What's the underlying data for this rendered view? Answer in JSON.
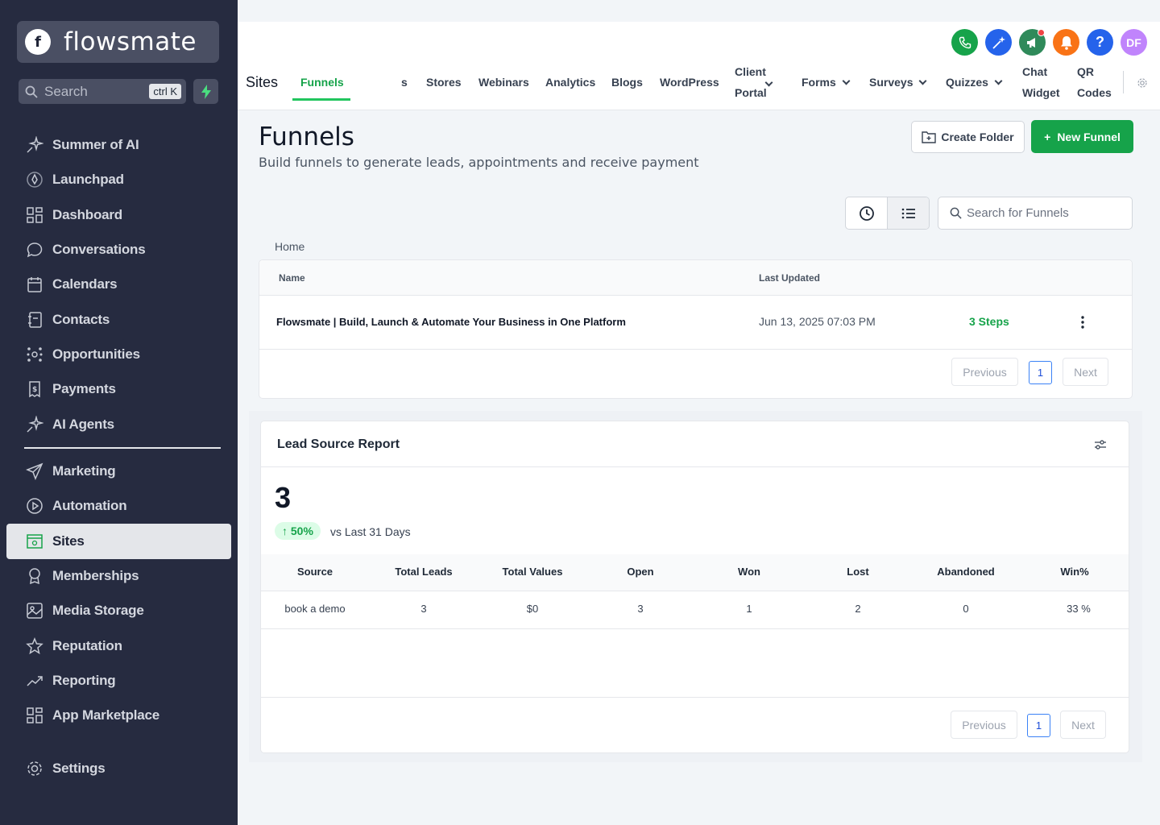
{
  "app": {
    "name": "flowsmate"
  },
  "sidebar": {
    "search_placeholder": "Search",
    "search_shortcut": "ctrl K",
    "items": [
      {
        "label": "Summer of AI",
        "icon": "sparkle-icon"
      },
      {
        "label": "Launchpad",
        "icon": "rocket-icon"
      },
      {
        "label": "Dashboard",
        "icon": "grid-icon"
      },
      {
        "label": "Conversations",
        "icon": "chat-bubble-icon"
      },
      {
        "label": "Calendars",
        "icon": "calendar-icon"
      },
      {
        "label": "Contacts",
        "icon": "contacts-icon"
      },
      {
        "label": "Opportunities",
        "icon": "opportunities-icon"
      },
      {
        "label": "Payments",
        "icon": "payments-icon"
      },
      {
        "label": "AI Agents",
        "icon": "sparkle-icon"
      },
      {
        "label": "Marketing",
        "icon": "send-icon"
      },
      {
        "label": "Automation",
        "icon": "automation-icon"
      },
      {
        "label": "Sites",
        "icon": "sites-icon"
      },
      {
        "label": "Memberships",
        "icon": "membership-icon"
      },
      {
        "label": "Media Storage",
        "icon": "image-icon"
      },
      {
        "label": "Reputation",
        "icon": "star-icon"
      },
      {
        "label": "Reporting",
        "icon": "trend-icon"
      },
      {
        "label": "App Marketplace",
        "icon": "grid-icon"
      },
      {
        "label": "Settings",
        "icon": "gear-icon"
      }
    ]
  },
  "topbar": {
    "section": "Sites",
    "avatar": "DF",
    "tabs": [
      {
        "label": "Funnels"
      },
      {
        "label": "s"
      },
      {
        "label": "Stores"
      },
      {
        "label": "Webinars"
      },
      {
        "label": "Analytics"
      },
      {
        "label": "Blogs"
      },
      {
        "label": "WordPress"
      },
      {
        "label": "Client",
        "label2": "Portal"
      },
      {
        "label": "Forms"
      },
      {
        "label": "Surveys"
      },
      {
        "label": "Quizzes"
      },
      {
        "label": "Chat",
        "label2": "Widget"
      },
      {
        "label": "QR",
        "label2": "Codes"
      }
    ],
    "colors": {
      "phone": "#16a34a",
      "magic": "#2563eb",
      "megaphone": "#2f8a5a",
      "bell": "#f97316",
      "help": "#2563eb",
      "avatar": "#c084fc"
    }
  },
  "main": {
    "title": "Funnels",
    "subtitle": "Build funnels to generate leads, appointments and receive payment",
    "create_folder": "Create Folder",
    "new_funnel": "New Funnel",
    "search_placeholder": "Search for Funnels",
    "breadcrumb": "Home",
    "table": {
      "headers": {
        "name": "Name",
        "updated": "Last Updated"
      },
      "rows": [
        {
          "name": "Flowsmate | Build, Launch & Automate Your Business in One Platform",
          "updated": "Jun 13, 2025 07:03 PM",
          "steps": "3 Steps"
        }
      ],
      "pager": {
        "prev": "Previous",
        "page": "1",
        "next": "Next"
      }
    }
  },
  "report": {
    "title": "Lead Source Report",
    "total": "3",
    "change": "50%",
    "vs": "vs Last 31 Days",
    "headers": [
      "Source",
      "Total Leads",
      "Total Values",
      "Open",
      "Won",
      "Lost",
      "Abandoned",
      "Win%"
    ],
    "rows": [
      [
        "book a demo",
        "3",
        "$0",
        "3",
        "1",
        "2",
        "0",
        "33 %"
      ]
    ],
    "pager": {
      "prev": "Previous",
      "page": "1",
      "next": "Next"
    }
  }
}
